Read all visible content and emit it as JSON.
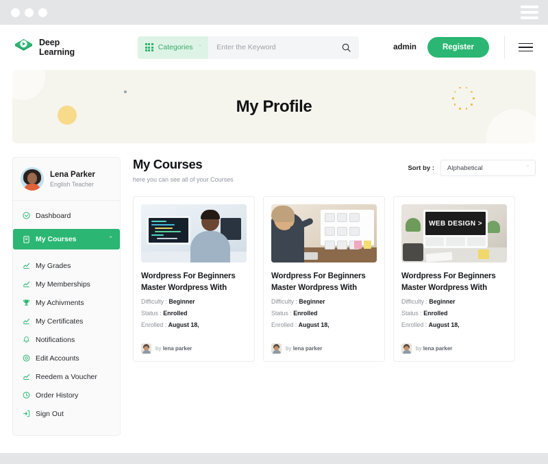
{
  "browser": {
    "dots": [
      "close",
      "minimize",
      "maximize"
    ],
    "menu_icon": "hamburger-icon"
  },
  "header": {
    "brand": {
      "line1": "Deep",
      "line2": "Learning",
      "logo_icon": "graduation-play-logo"
    },
    "categories": {
      "label": "Categories",
      "icon": "grid-icon",
      "caret": "ˇ"
    },
    "search": {
      "placeholder": "Enter the Keyword",
      "value": "",
      "icon": "search-icon"
    },
    "admin_label": "admin",
    "register_label": "Register",
    "menu_icon": "hamburger-icon"
  },
  "hero": {
    "title": "My Profile"
  },
  "sidebar": {
    "profile": {
      "name": "Lena Parker",
      "role": "English Teacher",
      "avatar": "user-avatar"
    },
    "items": [
      {
        "label": "Dashboard",
        "icon": "dashboard-icon",
        "active": false
      },
      {
        "label": "My Courses",
        "icon": "document-icon",
        "active": true,
        "chevron": "ˇ"
      },
      {
        "label": "My Grades",
        "icon": "chart-icon",
        "active": false
      },
      {
        "label": "My Memberships",
        "icon": "chart-icon",
        "active": false
      },
      {
        "label": "My Achivments",
        "icon": "trophy-icon",
        "active": false
      },
      {
        "label": "My Certificates",
        "icon": "chart-icon",
        "active": false
      },
      {
        "label": "Notifications",
        "icon": "bell-icon",
        "active": false
      },
      {
        "label": "Edit Accounts",
        "icon": "gear-icon",
        "active": false
      },
      {
        "label": "Reedem a Voucher",
        "icon": "chart-icon",
        "active": false
      },
      {
        "label": "Order History",
        "icon": "clock-icon",
        "active": false
      },
      {
        "label": "Sign Out",
        "icon": "sign-out-icon",
        "active": false
      }
    ]
  },
  "main": {
    "title": "My Courses",
    "subtitle": "here you can see all of your Courses",
    "sort": {
      "label": "Sort by :",
      "value": "Alphabetical",
      "chevron": "ˇ"
    },
    "meta_labels": {
      "difficulty": "Difficulty :",
      "status": "Status :",
      "enrolled": "Enrolled :",
      "by": "by"
    },
    "courses": [
      {
        "title_line1": "Wordpress For Beginners",
        "title_line2": "Master Wordpress With",
        "difficulty": "Beginner",
        "status": "Enrolled",
        "enrolled_date": "August 18,",
        "author": "lena parker",
        "thumb": "developer-at-desk-photo"
      },
      {
        "title_line1": "Wordpress For Beginners",
        "title_line2": "Master Wordpress With",
        "difficulty": "Beginner",
        "status": "Enrolled",
        "enrolled_date": "August 18,",
        "author": "lena parker",
        "thumb": "designer-sketching-photo"
      },
      {
        "title_line1": "Wordpress For Beginners",
        "title_line2": "Master Wordpress With",
        "difficulty": "Beginner",
        "status": "Enrolled",
        "enrolled_date": "August 18,",
        "author": "lena parker",
        "thumb": "web-design-desk-photo"
      }
    ]
  },
  "colors": {
    "brand_green": "#2bb673",
    "categories_bg": "#ddf3e6",
    "hero_bg": "#f5f4ed",
    "chrome_grey": "#e3e5e7",
    "accent_yellow": "#f7da8a"
  }
}
